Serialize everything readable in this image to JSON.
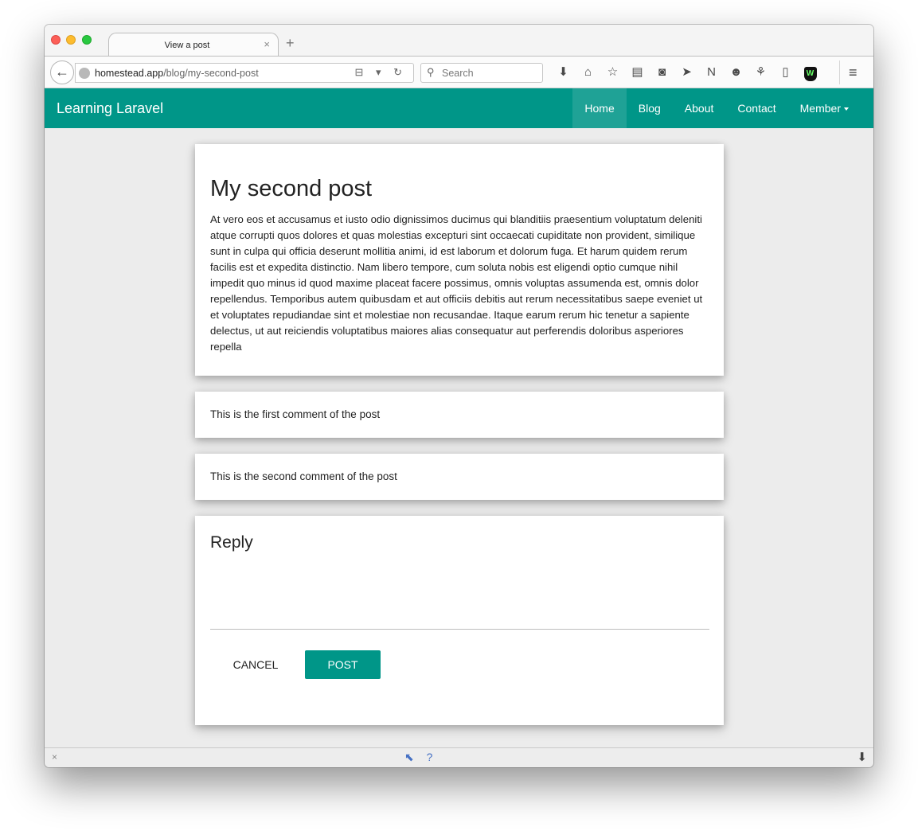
{
  "browser": {
    "tab_title": "View a post",
    "tab_close": "×",
    "new_tab": "+",
    "back": "←",
    "url_host": "homestead.app",
    "url_path": "/blog/my-second-post",
    "url_icons": "⊟ ▾ ↻",
    "search_glyph": "⚲",
    "search_placeholder": "Search",
    "toolbar_icons": [
      {
        "name": "download-icon",
        "glyph": "⬇"
      },
      {
        "name": "home-icon",
        "glyph": "⌂"
      },
      {
        "name": "bookmark-star-icon",
        "glyph": "☆"
      },
      {
        "name": "reading-list-icon",
        "glyph": "▤"
      },
      {
        "name": "pocket-icon",
        "glyph": "◙"
      },
      {
        "name": "send-icon",
        "glyph": "➤"
      },
      {
        "name": "n-extension-icon",
        "glyph": "N"
      },
      {
        "name": "chat-icon",
        "glyph": "☻"
      },
      {
        "name": "extension-icon",
        "glyph": "⚘"
      },
      {
        "name": "clipboard-icon",
        "glyph": "▯"
      }
    ],
    "ghostery_glyph": "W",
    "menu_glyph": "≡",
    "status_close": "×",
    "status_mid": "⬉ ?",
    "status_down": "⬇"
  },
  "site": {
    "brand": "Learning Laravel",
    "nav": {
      "home": "Home",
      "blog": "Blog",
      "about": "About",
      "contact": "Contact",
      "member": "Member"
    },
    "accent_color": "#009688"
  },
  "post": {
    "title": "My second post",
    "body": "At vero eos et accusamus et iusto odio dignissimos ducimus qui blanditiis praesentium voluptatum deleniti atque corrupti quos dolores et quas molestias excepturi sint occaecati cupiditate non provident, similique sunt in culpa qui officia deserunt mollitia animi, id est laborum et dolorum fuga. Et harum quidem rerum facilis est et expedita distinctio. Nam libero tempore, cum soluta nobis est eligendi optio cumque nihil impedit quo minus id quod maxime placeat facere possimus, omnis voluptas assumenda est, omnis dolor repellendus. Temporibus autem quibusdam et aut officiis debitis aut rerum necessitatibus saepe eveniet ut et voluptates repudiandae sint et molestiae non recusandae. Itaque earum rerum hic tenetur a sapiente delectus, ut aut reiciendis voluptatibus maiores alias consequatur aut perferendis doloribus asperiores repella"
  },
  "comments": [
    "This is the first comment of the post",
    "This is the second comment of the post"
  ],
  "reply": {
    "title": "Reply",
    "text_value": "",
    "cancel_label": "CANCEL",
    "post_label": "POST"
  }
}
